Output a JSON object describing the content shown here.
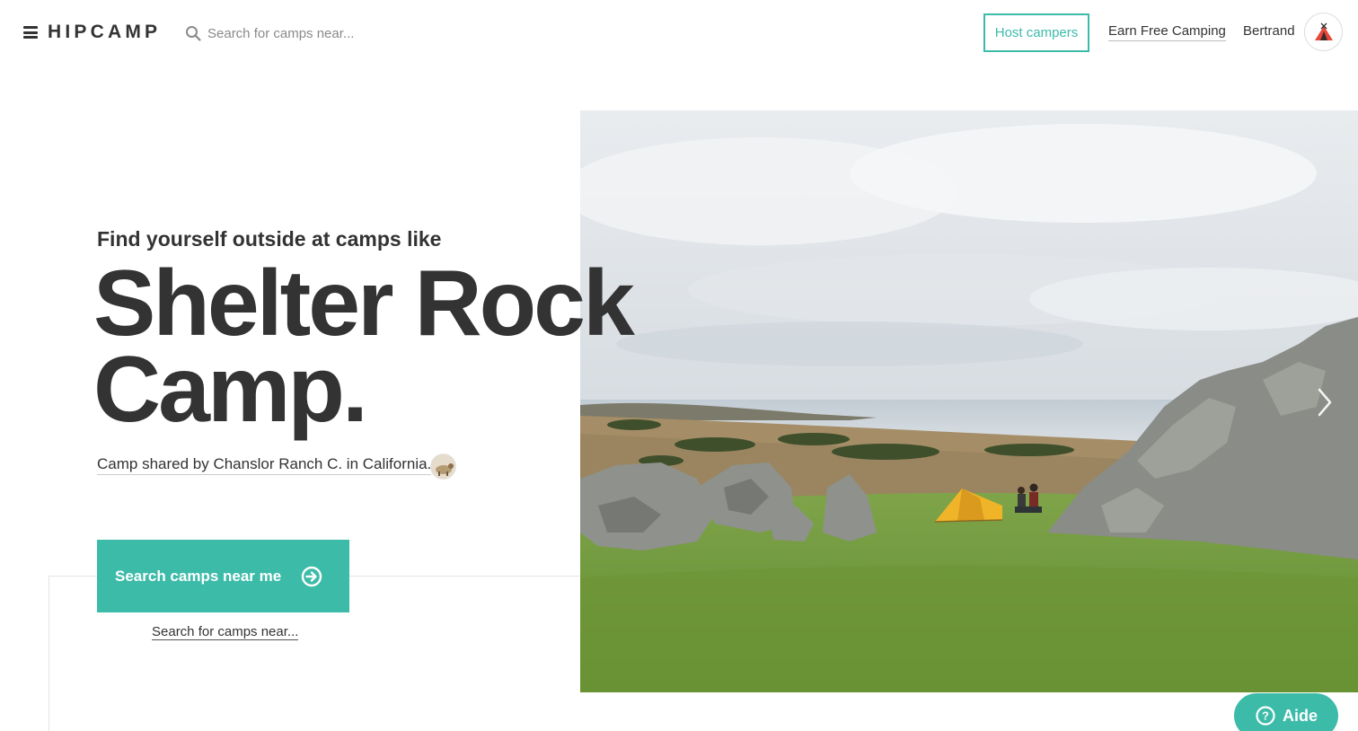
{
  "header": {
    "logo_text": "HIPCAMP",
    "search_placeholder": "Search for camps near...",
    "host_button": "Host campers",
    "earn_link": "Earn Free Camping",
    "user_name": "Bertrand",
    "icons": {
      "menu": "hamburger-icon",
      "search": "search-icon",
      "avatar": "tent-icon"
    }
  },
  "hero": {
    "eyebrow": "Find yourself outside at camps like",
    "camp_name_line1": "Shelter Rock",
    "camp_name_line2": "Camp.",
    "shared_by": "Camp shared by Chanslor Ranch C. in California.",
    "cta_label": "Search camps near me",
    "search_link": "Search for camps near...",
    "image_alt": "Yellow tent on green grass among rocks overlooking the coast"
  },
  "help": {
    "label": "Aide"
  },
  "colors": {
    "accent": "#3dbba9",
    "text": "#333333",
    "tent": "#f0b429"
  }
}
